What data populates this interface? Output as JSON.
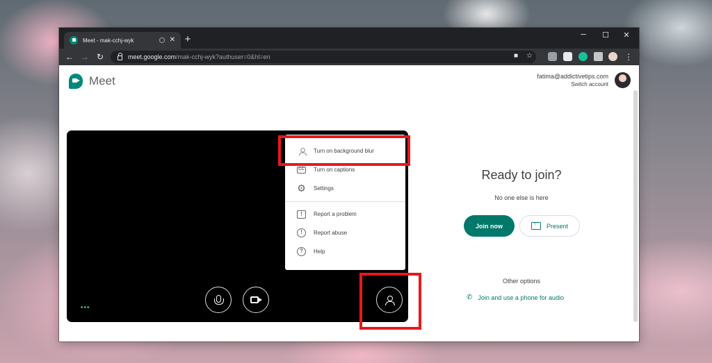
{
  "browser": {
    "tab_title": "Meet - mak-cchj-wyk",
    "tab_close": "✕",
    "new_tab": "+",
    "window_controls": {
      "minimize": "─",
      "maximize": "☐",
      "close": "✕"
    },
    "nav": {
      "back": "←",
      "forward": "→",
      "reload": "↻"
    },
    "url_host": "meet.google.com",
    "url_path": "/mak-cchj-wyk?authuser=0&hl=en",
    "omnibox_icons": [
      "camera-icon",
      "star-icon"
    ],
    "extension_icons": [
      "drive-icon",
      "note-icon",
      "grammarly-icon",
      "puzzle-icon",
      "profile-avatar-icon",
      "menu-dots-icon"
    ],
    "menu_dots": "⋮"
  },
  "header": {
    "logo_text": "Meet",
    "account_email": "fatima@addictivetips.com",
    "switch_account": "Switch account"
  },
  "preview": {
    "indicator": "•••",
    "controls": [
      "microphone-icon",
      "camera-icon",
      "background-blur-icon"
    ]
  },
  "menu": {
    "items": [
      {
        "label": "Turn on background blur",
        "icon": "background-blur-icon"
      },
      {
        "label": "Turn on captions",
        "icon": "captions-icon",
        "glyph": "CC"
      },
      {
        "label": "Settings",
        "icon": "gear-icon",
        "glyph": "⚙"
      },
      {
        "label": "Report a problem",
        "icon": "report-problem-icon",
        "glyph": "!"
      },
      {
        "label": "Report abuse",
        "icon": "report-abuse-icon",
        "glyph": "!"
      },
      {
        "label": "Help",
        "icon": "help-icon",
        "glyph": "?"
      }
    ]
  },
  "join_panel": {
    "title": "Ready to join?",
    "subtitle": "No one else is here",
    "join_button": "Join now",
    "present_button": "Present",
    "other_options": "Other options",
    "phone_link": "Join and use a phone for audio"
  },
  "colors": {
    "accent": "#00796b",
    "highlight": "#e8181c",
    "chrome_dark": "#202124"
  }
}
